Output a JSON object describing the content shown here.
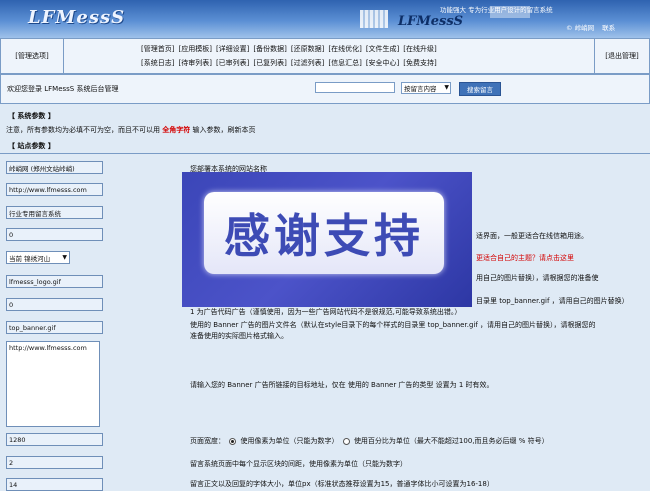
{
  "header": {
    "logo": "LFMessS",
    "logo_small": "LFMessS",
    "slogan": "功能强大 专为行业用户设计的留言系统",
    "links": [
      "© 峠峭网",
      "联系"
    ]
  },
  "nav": {
    "left": "[管理选项]",
    "right": "[退出管理]",
    "row1": [
      "[管理首页]",
      "[应用模板]",
      "[详细设置]",
      "[备份数据]",
      "[还原数据]",
      "[在线优化]",
      "[文件生成]",
      "[在线升级]"
    ],
    "row2": [
      "[系统日志]",
      "[待审列表]",
      "[已审列表]",
      "[已复列表]",
      "[过滤列表]",
      "[信息汇总]",
      "[安全中心]",
      "[免费支持]"
    ]
  },
  "welcome": {
    "text": "欢迎您登录 LFMessS 系统后台管理",
    "search_value": "",
    "search_select": "按留言内容",
    "search_button": "搜索留言"
  },
  "sections": {
    "system_params": "【 系统参数 】",
    "notice_prefix": "注意，所有参数均为必填不可为空，而且不可以用",
    "notice_red": "全角字符",
    "notice_suffix": "输入参数，刷新本页",
    "site_params": "【 站点参数 】"
  },
  "fields": {
    "site_name": "峠峭网 (郑州文站峠峭)",
    "site_url": "http://www.lfmesss.com",
    "system_name": "行业专用留言系统",
    "mode": "0",
    "template": "当前 锦绣河山",
    "logo_file": "lfmesss_logo.gif",
    "banner_type": "0",
    "banner_file": "top_banner.gif",
    "banner_link": "http://www.lfmesss.com",
    "page_width": "1280",
    "spacing": "2",
    "font_size": "14"
  },
  "descriptions": {
    "site_name": "您部署本系统的网站名称",
    "mode": "适界面，一般更适合在线信箱用途。",
    "template_red": "更适合自己的主题？请点击这里",
    "logo": "用自己的图片替换），请根据您的准备使",
    "banner_type": "1 为广告代码广告（谨慎使用，因为一些广告网站代码不是很规范,可能导致系统出错。）",
    "banner_partial": "目录里 top_banner.gif ，请用自己的图片替换）",
    "banner_file_1": "使用的 Banner 广告的图片文件名（默认在style目录下的每个样式的目录里 top_banner.gif ，请用自己的图片替换），请根据您的",
    "banner_file_2": "准备使用的实际图片格式输入。",
    "banner_link": "请输入您的 Banner 广告所链接的目标地址，仅在 使用的 Banner 广告的类型 设置为 1 时有效。",
    "width_prefix": "页面宽度：",
    "width_opt1": "使用像素为单位（只能为数字）",
    "width_opt2": "使用百分比为单位（最大不能超过100,而且务必后缀 % 符号）",
    "spacing": "留言系统页面中每个显示区块的间距，使用像素为单位（只能为数字）",
    "font_size": "留言正文以及回复的字体大小，单位px（标准状态推荐设置为15，普通字体比小可设置为16-18）"
  },
  "overlay": {
    "text": "感谢支持"
  }
}
